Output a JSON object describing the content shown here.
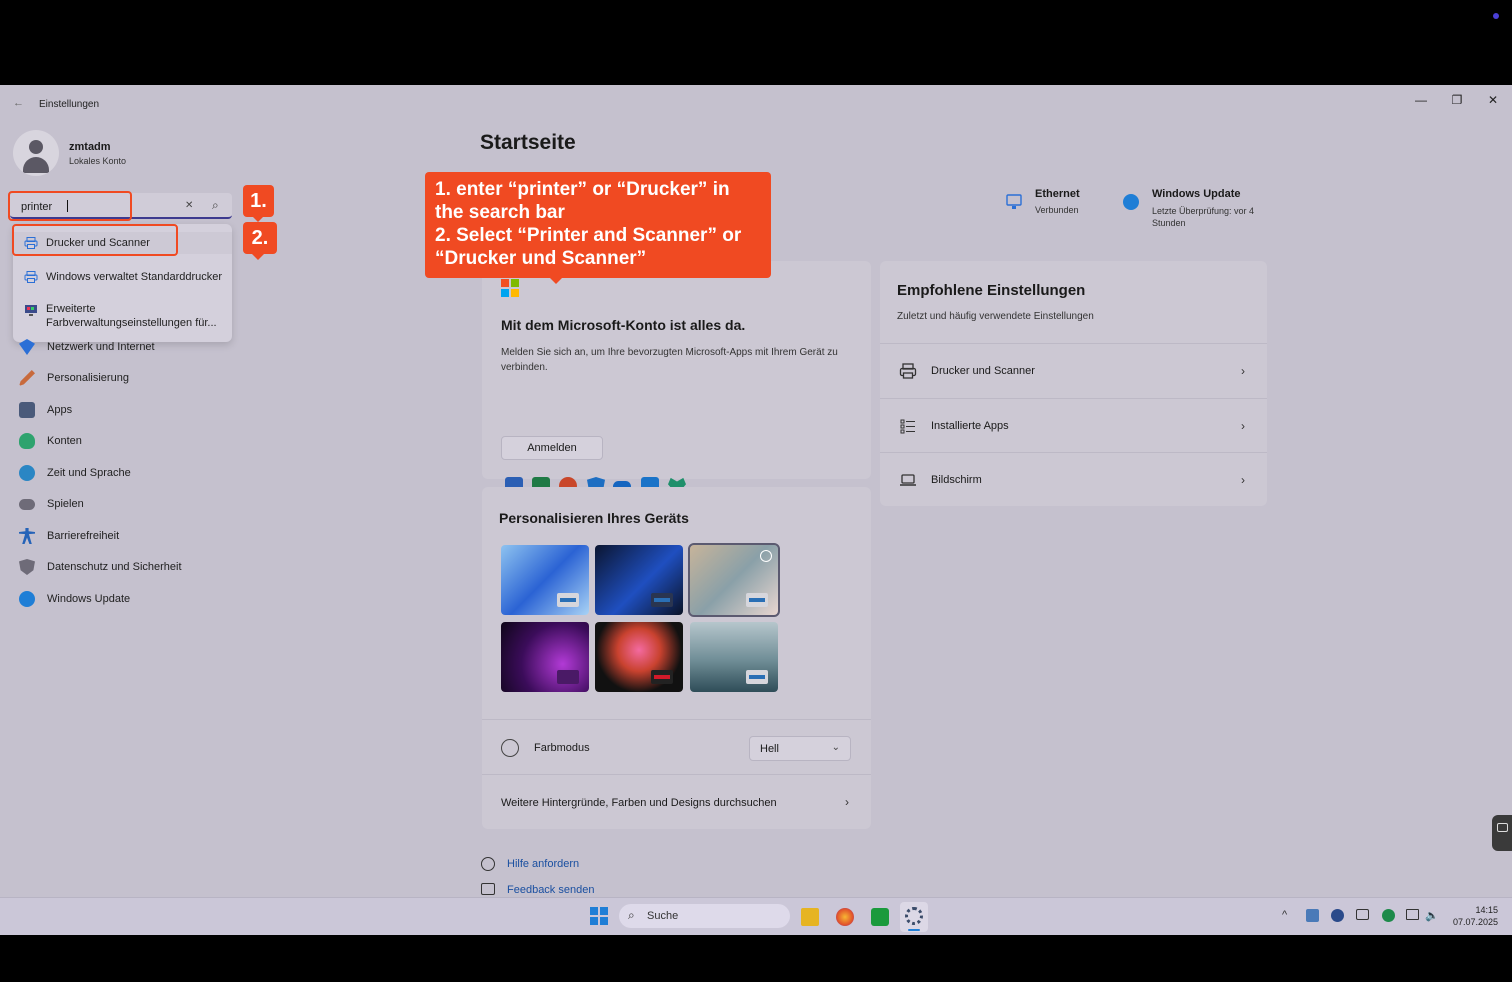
{
  "window": {
    "title": "Einstellungen",
    "controls": {
      "minimize": "—",
      "maximize": "❐",
      "close": "✕"
    },
    "back_icon": "←"
  },
  "user": {
    "name": "zmtadm",
    "account_type": "Lokales Konto"
  },
  "search": {
    "value": "printer",
    "clear_icon": "✕",
    "search_icon": "⌕",
    "results": [
      {
        "label": "Drucker und Scanner"
      },
      {
        "label": "Windows verwaltet Standarddrucker"
      },
      {
        "label": "Erweiterte Farbverwaltungseinstellungen für..."
      }
    ]
  },
  "sidebar": {
    "items": [
      {
        "label": "Netzwerk und Internet",
        "color": "#2b6fd6"
      },
      {
        "label": "Personalisierung",
        "color": "#c86a3c"
      },
      {
        "label": "Apps",
        "color": "#4a5a7a"
      },
      {
        "label": "Konten",
        "color": "#2ea36e"
      },
      {
        "label": "Zeit und Sprache",
        "color": "#2a86c4"
      },
      {
        "label": "Spielen",
        "color": "#6e6b78"
      },
      {
        "label": "Barrierefreiheit",
        "color": "#2563b8"
      },
      {
        "label": "Datenschutz und Sicherheit",
        "color": "#6e6b78"
      },
      {
        "label": "Windows Update",
        "color": "#1f7ed6"
      }
    ]
  },
  "annotations": {
    "step1": "1.",
    "step2": "2.",
    "instruction": "1. enter “printer” or “Drucker” in the search bar\n2. Select “Printer and Scanner” or “Drucker und Scanner”"
  },
  "main": {
    "title": "Startseite",
    "status": {
      "ethernet": {
        "title": "Ethernet",
        "subtitle": "Verbunden"
      },
      "update": {
        "title": "Windows Update",
        "subtitle": "Letzte Überprüfung: vor 4 Stunden"
      }
    },
    "ms_account": {
      "title": "Mit dem Microsoft-Konto ist alles da.",
      "description": "Melden Sie sich an, um Ihre bevorzugten Microsoft-Apps mit Ihrem Gerät zu verbinden.",
      "button": "Anmelden",
      "app_icons": [
        "word-icon",
        "excel-icon",
        "powerpoint-icon",
        "defender-icon",
        "onedrive-icon",
        "outlook-icon",
        "family-icon"
      ]
    },
    "personalize": {
      "title": "Personalisieren Ihres Geräts",
      "color_mode_label": "Farbmodus",
      "color_mode_value": "Hell",
      "browse_link": "Weitere Hintergründe, Farben und Designs durchsuchen"
    },
    "recommended": {
      "title": "Empfohlene Einstellungen",
      "subtitle": "Zuletzt und häufig verwendete Einstellungen",
      "items": [
        {
          "label": "Drucker und Scanner"
        },
        {
          "label": "Installierte Apps"
        },
        {
          "label": "Bildschirm"
        }
      ]
    },
    "help_links": {
      "help": "Hilfe anfordern",
      "feedback": "Feedback senden"
    }
  },
  "taskbar": {
    "search_placeholder": "Suche",
    "time": "14:15",
    "date": "07.07.2025"
  },
  "colors": {
    "accent": "#3d3a8f",
    "callout": "#f04a22",
    "window_bg": "#c5c1ce"
  }
}
